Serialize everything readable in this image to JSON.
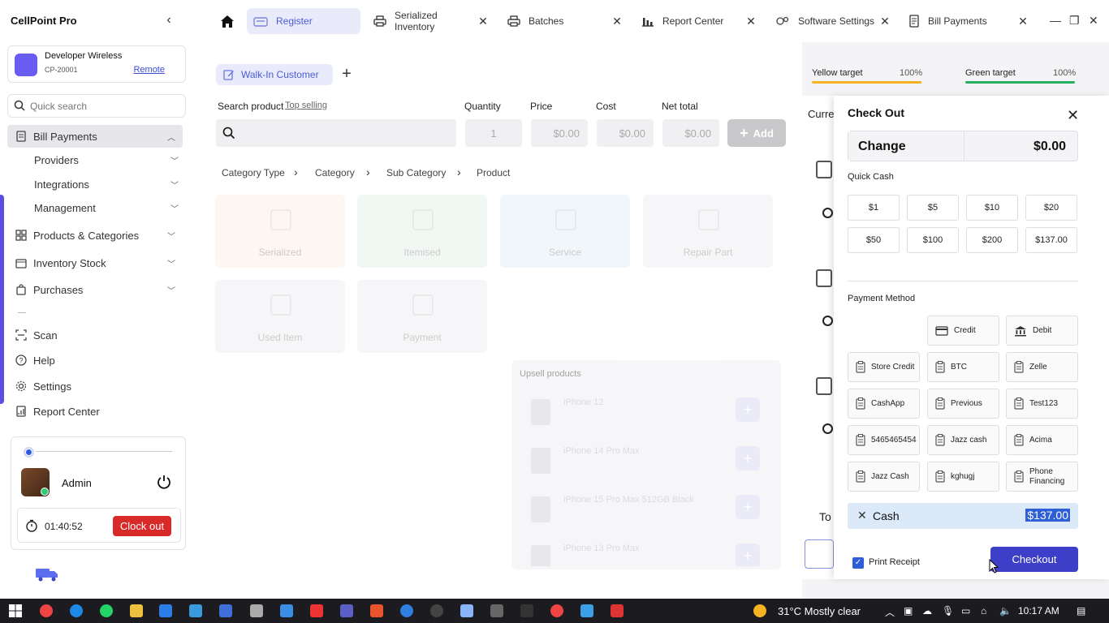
{
  "app": {
    "title": "CellPoint Pro"
  },
  "store": {
    "name": "Developer Wireless",
    "id": "CP-20001",
    "remote_label": "Remote"
  },
  "sidebar": {
    "search_placeholder": "Quick search",
    "items": [
      {
        "label": "Bill Payments",
        "icon": "bill-icon",
        "expanded": true
      },
      {
        "label": "Products & Categories",
        "icon": "grid-icon"
      },
      {
        "label": "Inventory Stock",
        "icon": "box-icon"
      },
      {
        "label": "Purchases",
        "icon": "bag-icon"
      },
      {
        "label": "Scan",
        "icon": "scan-icon"
      },
      {
        "label": "Help",
        "icon": "help-icon"
      },
      {
        "label": "Settings",
        "icon": "gear-icon"
      },
      {
        "label": "Report Center",
        "icon": "report-icon"
      }
    ],
    "sub_items": [
      "Providers",
      "Integrations",
      "Management"
    ]
  },
  "user": {
    "name": "Admin",
    "timer": "01:40:52",
    "clockout_label": "Clock out"
  },
  "tabs": [
    {
      "label": "Register",
      "icon": "register-icon"
    },
    {
      "label": "Serialized Inventory",
      "icon": "printer-icon"
    },
    {
      "label": "Batches",
      "icon": "printer-icon"
    },
    {
      "label": "Report Center",
      "icon": "chart-icon"
    },
    {
      "label": "Software Settings",
      "icon": "settings-icon"
    },
    {
      "label": "Bill Payments",
      "icon": "bill-icon"
    }
  ],
  "register": {
    "customer_label": "Walk-In Customer",
    "search_product_label": "Search product",
    "top_selling_label": "Top selling",
    "quantity_label": "Quantity",
    "price_label": "Price",
    "cost_label": "Cost",
    "net_total_label": "Net total",
    "quantity_value": "1",
    "price_value": "$0.00",
    "cost_value": "$0.00",
    "net_total_value": "$0.00",
    "add_label": "Add",
    "breadcrumb": [
      "Category Type",
      "Category",
      "Sub Category",
      "Product"
    ],
    "categories": [
      "Serialized",
      "Itemised",
      "Service",
      "Repair Part",
      "Used Item",
      "Payment"
    ],
    "upsell_title": "Upsell products",
    "upsell_items": [
      "iPhone 12",
      "iPhone 14 Pro Max",
      "iPhone 15 Pro Max 512GB Black",
      "iPhone 13 Pro Max"
    ]
  },
  "targets": {
    "yellow_label": "Yellow target",
    "yellow_pct": "100%",
    "green_label": "Green target",
    "green_pct": "100%"
  },
  "right_panel": {
    "current_label": "Curre",
    "total_label": "To"
  },
  "checkout": {
    "title": "Check Out",
    "change_label": "Change",
    "change_value": "$0.00",
    "quick_cash_label": "Quick Cash",
    "quick_cash": [
      "$1",
      "$5",
      "$10",
      "$20",
      "$50",
      "$100",
      "$200",
      "$137.00"
    ],
    "payment_method_label": "Payment Method",
    "payment_methods": [
      {
        "label": "Credit",
        "icon": "card-icon"
      },
      {
        "label": "Debit",
        "icon": "bank-icon"
      },
      {
        "label": "Store Credit",
        "icon": "clipboard-icon"
      },
      {
        "label": "BTC",
        "icon": "clipboard-icon"
      },
      {
        "label": "Zelle",
        "icon": "clipboard-icon"
      },
      {
        "label": "CashApp",
        "icon": "clipboard-icon"
      },
      {
        "label": "Previous",
        "icon": "clipboard-icon"
      },
      {
        "label": "Test123",
        "icon": "clipboard-icon"
      },
      {
        "label": "5465465454",
        "icon": "clipboard-icon"
      },
      {
        "label": "Jazz cash",
        "icon": "clipboard-icon"
      },
      {
        "label": "Acima",
        "icon": "clipboard-icon"
      },
      {
        "label": "Jazz Cash",
        "icon": "clipboard-icon"
      },
      {
        "label": "kghugj",
        "icon": "clipboard-icon"
      },
      {
        "label": "Phone Financing",
        "icon": "clipboard-icon"
      }
    ],
    "selected_payment": {
      "label": "Cash",
      "amount": "$137.00"
    },
    "print_receipt_label": "Print Receipt",
    "print_receipt_checked": true,
    "checkout_label": "Checkout"
  },
  "taskbar": {
    "weather": "31°C  Mostly clear",
    "time": "10:17 AM"
  },
  "colors": {
    "accent": "#3d3fc9",
    "danger": "#d92a2a",
    "selected_payment_bg": "#dbe9f8",
    "yellow_target": "#f5b324",
    "green_target": "#27ae60"
  }
}
